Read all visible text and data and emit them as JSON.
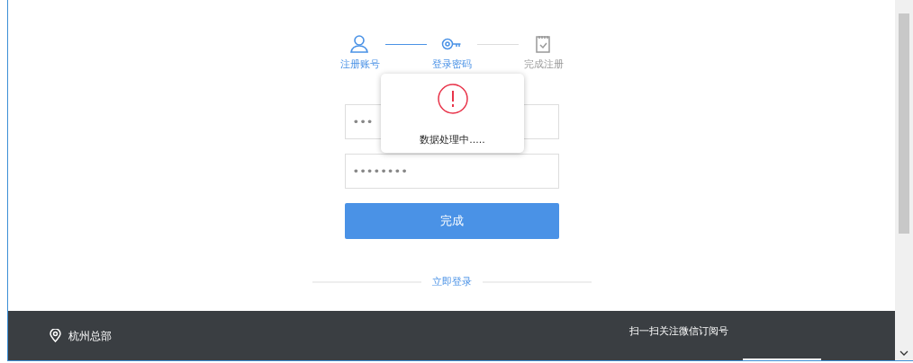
{
  "steps": [
    {
      "label": "注册账号",
      "kind": "user",
      "done": true
    },
    {
      "label": "登录密码",
      "kind": "key",
      "done": true
    },
    {
      "label": "完成注册",
      "kind": "clipboard",
      "done": false
    }
  ],
  "fields": [
    {
      "value": "•••"
    },
    {
      "value": "••••••••"
    }
  ],
  "submit": "完成",
  "login_link": "立即登录",
  "dialog": {
    "message": "数据处理中....."
  },
  "footer": {
    "location": "杭州总部",
    "subscribe": "扫一扫关注微信订阅号"
  }
}
